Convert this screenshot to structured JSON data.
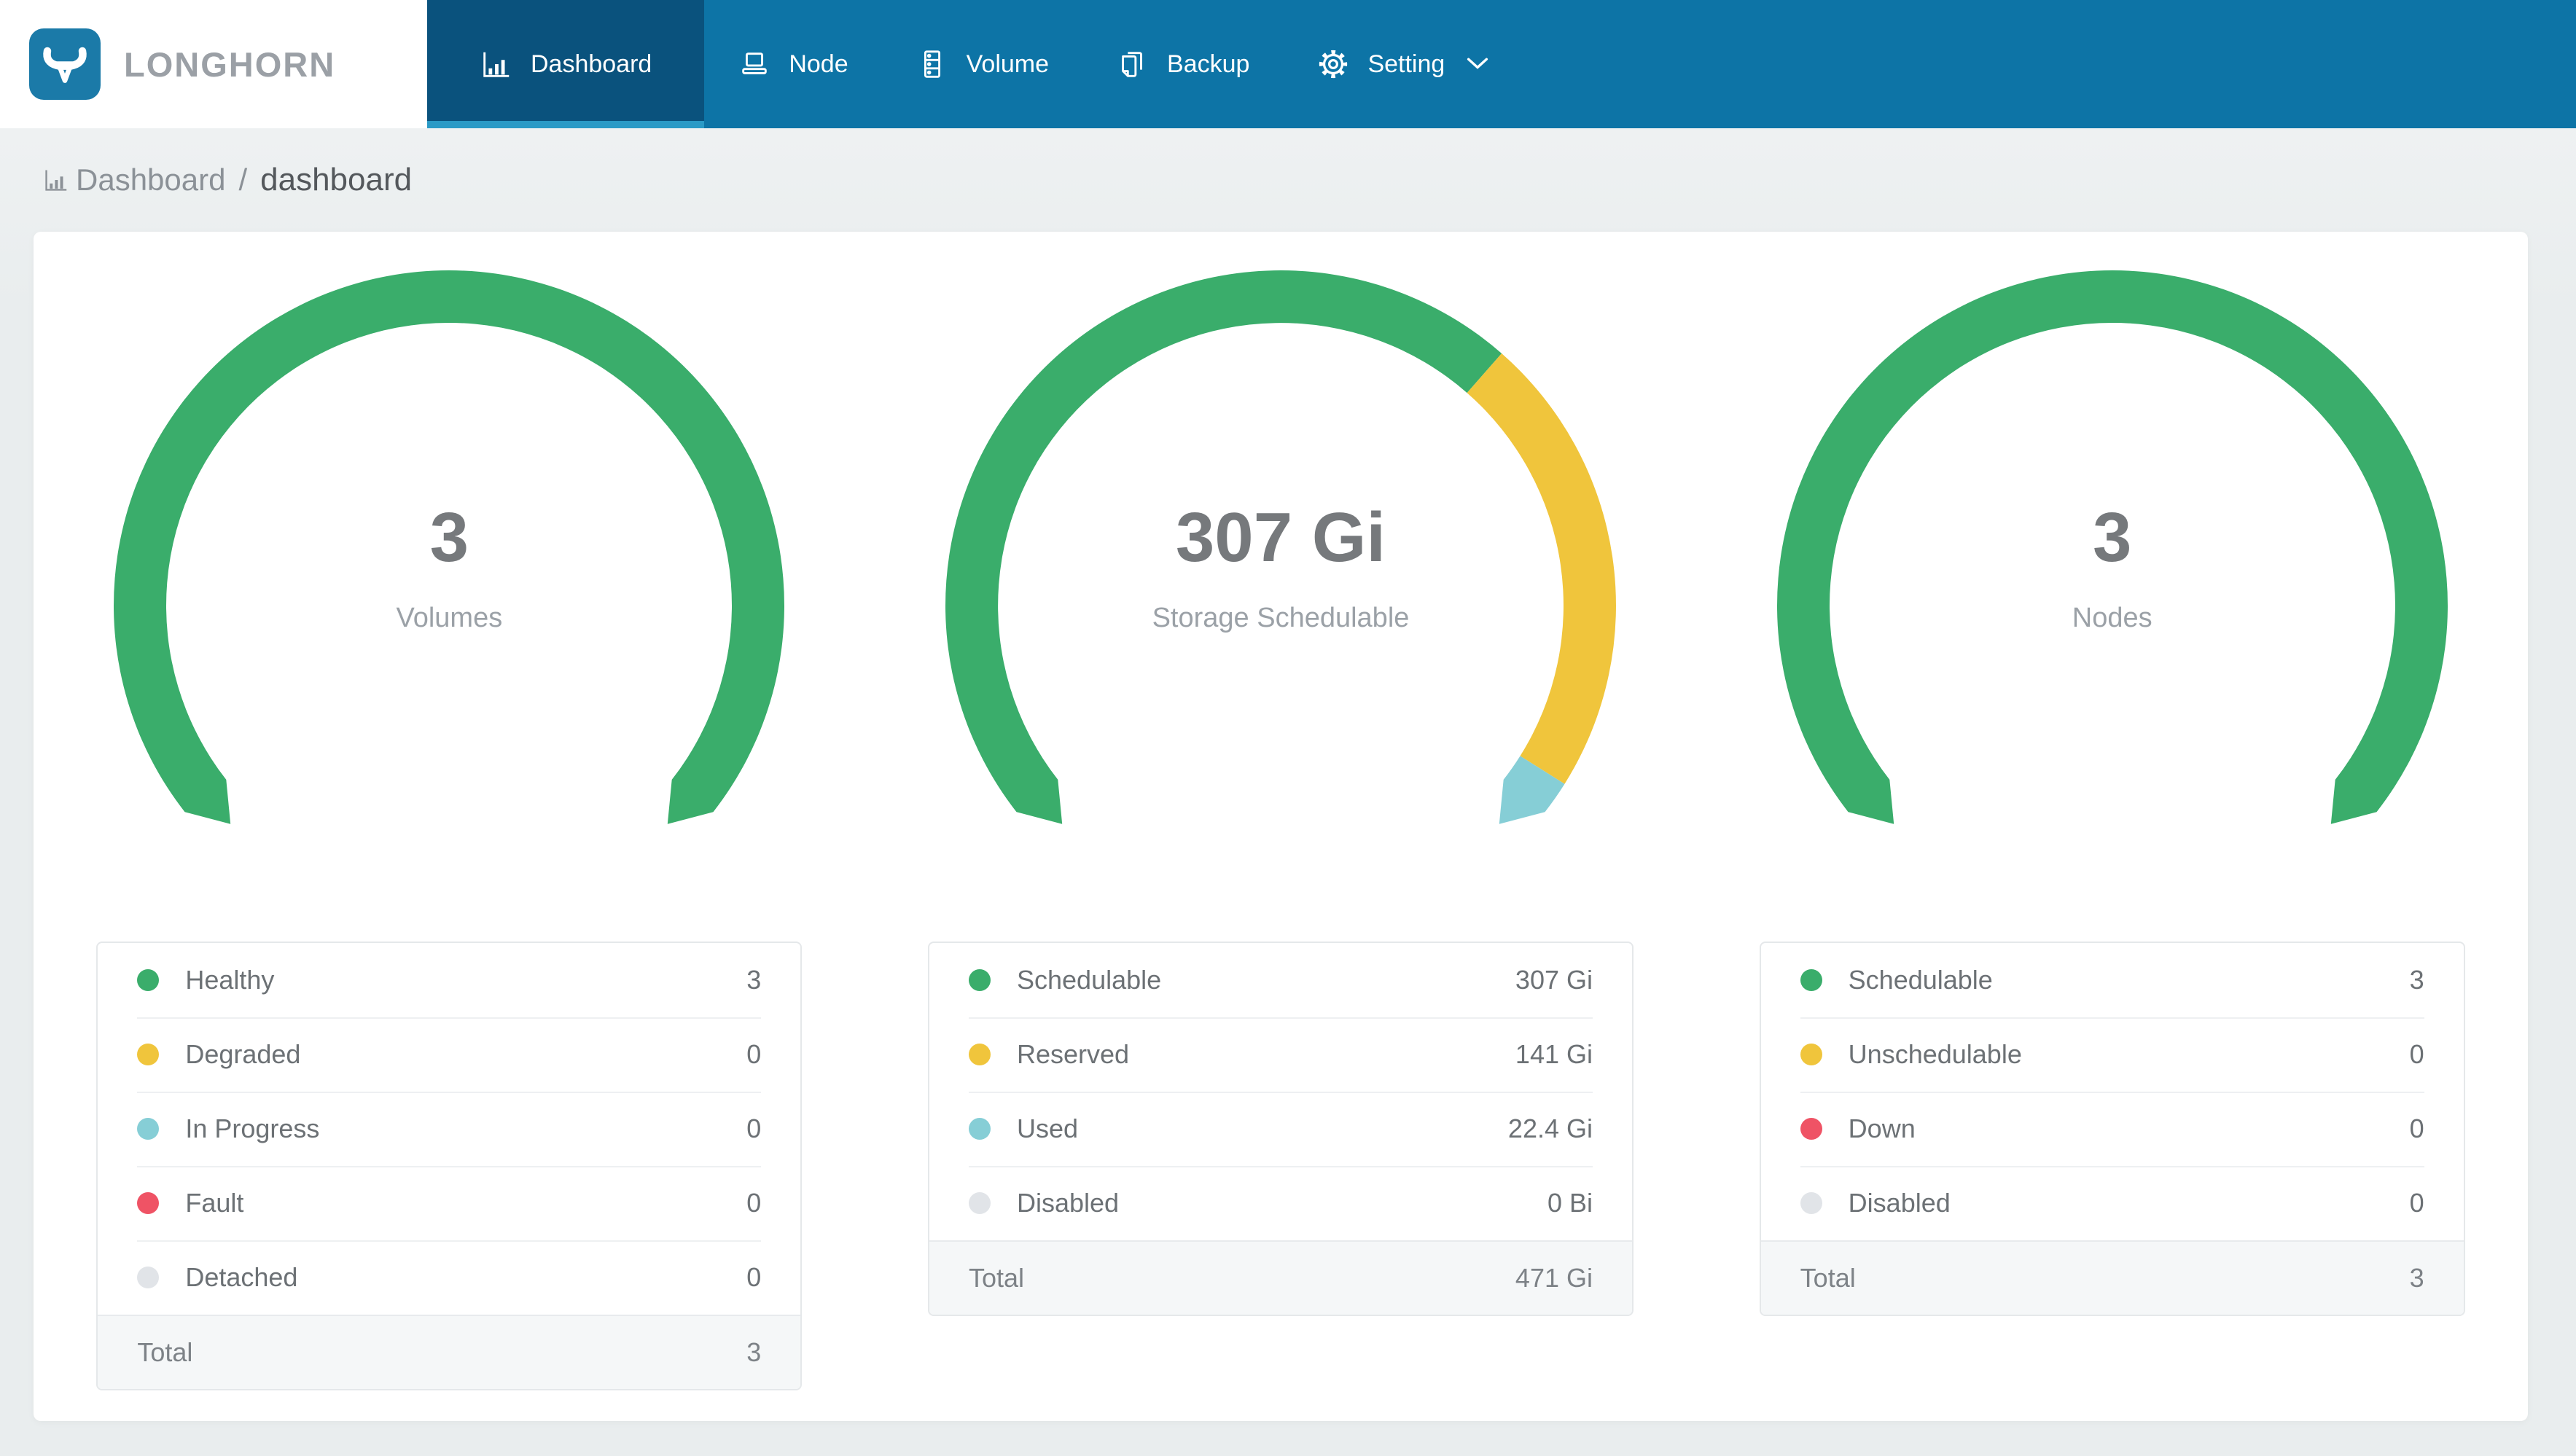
{
  "nav": {
    "brand": "LONGHORN",
    "items": [
      {
        "label": "Dashboard",
        "icon": "bar-chart-icon",
        "active": true
      },
      {
        "label": "Node",
        "icon": "laptop-icon",
        "active": false
      },
      {
        "label": "Volume",
        "icon": "server-icon",
        "active": false
      },
      {
        "label": "Backup",
        "icon": "copy-document-icon",
        "active": false
      },
      {
        "label": "Setting",
        "icon": "gear-icon",
        "active": false,
        "has_dropdown": true
      }
    ]
  },
  "breadcrumb": {
    "section": "Dashboard",
    "separator": "/",
    "page": "dashboard"
  },
  "colors": {
    "green": "#3aad6b",
    "yellow": "#f0c53c",
    "teal": "#86ced6",
    "red": "#ef5365",
    "gray": "#e1e4e8",
    "nav_bg": "#0d74a6",
    "nav_active_bg": "#0a527d",
    "nav_active_indicator": "#2a9ac6",
    "logo_blue": "#1b7aa8"
  },
  "chart_data": [
    {
      "type": "donut-gauge",
      "arc_span_deg": 270,
      "center_value": "3",
      "center_label": "Volumes",
      "segments": [
        {
          "label": "Healthy",
          "value": 3,
          "color": "#3aad6b"
        },
        {
          "label": "Degraded",
          "value": 0,
          "color": "#f0c53c"
        },
        {
          "label": "In Progress",
          "value": 0,
          "color": "#86ced6"
        },
        {
          "label": "Fault",
          "value": 0,
          "color": "#ef5365"
        },
        {
          "label": "Detached",
          "value": 0,
          "color": "#e1e4e8"
        }
      ],
      "total": 3
    },
    {
      "type": "donut-gauge",
      "arc_span_deg": 270,
      "center_value": "307 Gi",
      "center_label": "Storage Schedulable",
      "segments": [
        {
          "label": "Schedulable",
          "value": 307,
          "color": "#3aad6b"
        },
        {
          "label": "Reserved",
          "value": 141,
          "color": "#f0c53c"
        },
        {
          "label": "Used",
          "value": 22.4,
          "color": "#86ced6"
        },
        {
          "label": "Disabled",
          "value": 0,
          "color": "#e1e4e8"
        }
      ],
      "total": 471,
      "unit": "Gi"
    },
    {
      "type": "donut-gauge",
      "arc_span_deg": 270,
      "center_value": "3",
      "center_label": "Nodes",
      "segments": [
        {
          "label": "Schedulable",
          "value": 3,
          "color": "#3aad6b"
        },
        {
          "label": "Unschedulable",
          "value": 0,
          "color": "#f0c53c"
        },
        {
          "label": "Down",
          "value": 0,
          "color": "#ef5365"
        },
        {
          "label": "Disabled",
          "value": 0,
          "color": "#e1e4e8"
        }
      ],
      "total": 3
    }
  ],
  "panels": [
    {
      "rows": [
        {
          "label": "Healthy",
          "value": "3",
          "color": "#3aad6b"
        },
        {
          "label": "Degraded",
          "value": "0",
          "color": "#f0c53c"
        },
        {
          "label": "In Progress",
          "value": "0",
          "color": "#86ced6"
        },
        {
          "label": "Fault",
          "value": "0",
          "color": "#ef5365"
        },
        {
          "label": "Detached",
          "value": "0",
          "color": "#e1e4e8"
        }
      ],
      "total": {
        "label": "Total",
        "value": "3"
      }
    },
    {
      "rows": [
        {
          "label": "Schedulable",
          "value": "307 Gi",
          "color": "#3aad6b"
        },
        {
          "label": "Reserved",
          "value": "141 Gi",
          "color": "#f0c53c"
        },
        {
          "label": "Used",
          "value": "22.4 Gi",
          "color": "#86ced6"
        },
        {
          "label": "Disabled",
          "value": "0 Bi",
          "color": "#e1e4e8"
        }
      ],
      "total": {
        "label": "Total",
        "value": "471 Gi"
      }
    },
    {
      "rows": [
        {
          "label": "Schedulable",
          "value": "3",
          "color": "#3aad6b"
        },
        {
          "label": "Unschedulable",
          "value": "0",
          "color": "#f0c53c"
        },
        {
          "label": "Down",
          "value": "0",
          "color": "#ef5365"
        },
        {
          "label": "Disabled",
          "value": "0",
          "color": "#e1e4e8"
        }
      ],
      "total": {
        "label": "Total",
        "value": "3"
      }
    }
  ]
}
